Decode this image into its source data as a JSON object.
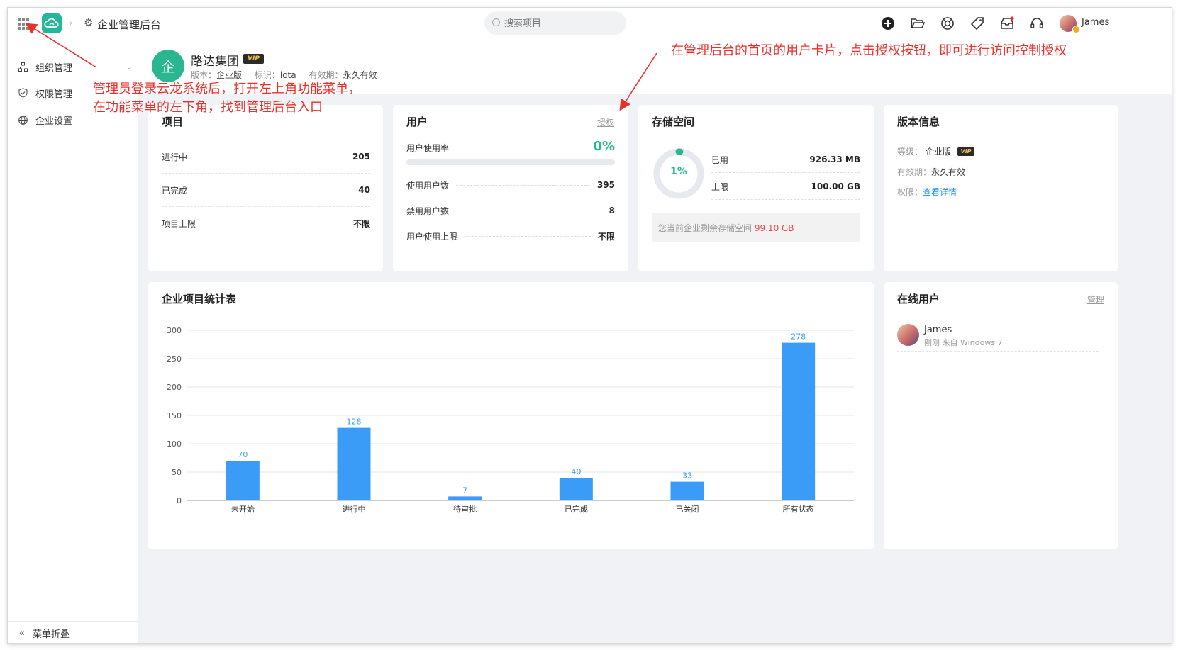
{
  "topbar": {
    "breadcrumb_title": "企业管理后台",
    "search_placeholder": "搜索项目",
    "user_name": "James",
    "icons": [
      "apps-grid-icon",
      "cloud-logo-icon",
      "chevron-right-icon",
      "gear-icon",
      "search-icon",
      "add-circle-icon",
      "folder-open-icon",
      "support-ring-icon",
      "tag-icon",
      "inbox-icon",
      "headset-icon"
    ]
  },
  "sidebar": {
    "items": [
      {
        "label": "组织管理",
        "icon": "org-chart-icon",
        "has_chevron": true
      },
      {
        "label": "权限管理",
        "icon": "shield-check-icon"
      },
      {
        "label": "企业设置",
        "icon": "globe-icon"
      }
    ],
    "collapse_label": "菜单折叠"
  },
  "company": {
    "logo_char": "企",
    "name": "路达集团",
    "vip_label": "VIP",
    "edition_label": "版本：",
    "edition_value": "企业版",
    "id_label": "标识：",
    "id_value": "lota",
    "validity_label": "有效期：",
    "validity_value": "永久有效"
  },
  "projects_card": {
    "title": "项目",
    "rows": [
      {
        "label": "进行中",
        "value": "205"
      },
      {
        "label": "已完成",
        "value": "40"
      },
      {
        "label": "项目上限",
        "value": "不限"
      }
    ]
  },
  "users_card": {
    "title": "用户",
    "authorize_link": "授权",
    "usage_label": "用户使用率",
    "usage_value": "0%",
    "usage_fraction": 0,
    "rows": [
      {
        "label": "使用用户数",
        "value": "395"
      },
      {
        "label": "禁用用户数",
        "value": "8"
      },
      {
        "label": "用户使用上限",
        "value": "不限"
      }
    ]
  },
  "storage_card": {
    "title": "存储空间",
    "percent_label": "1%",
    "percent_fraction": 0.01,
    "used_label": "已用",
    "used_value": "926.33 MB",
    "limit_label": "上限",
    "limit_value": "100.00 GB",
    "note_text": "您当前企业剩余存储空间",
    "note_remaining": "99.10 GB"
  },
  "version_card": {
    "title": "版本信息",
    "level_label": "等级：",
    "level_value": "企业版",
    "vip_label": "VIP",
    "validity_label": "有效期：",
    "validity_value": "永久有效",
    "permission_label": "权限：",
    "permission_link": "查看详情"
  },
  "chart_card": {
    "title": "企业项目统计表"
  },
  "chart_data": {
    "type": "bar",
    "title": "企业项目统计表",
    "categories": [
      "未开始",
      "进行中",
      "待审批",
      "已完成",
      "已关闭",
      "所有状态"
    ],
    "values": [
      70,
      128,
      7,
      40,
      33,
      278
    ],
    "ylim": [
      0,
      300
    ],
    "yticks": [
      0,
      50,
      100,
      150,
      200,
      250,
      300
    ],
    "grid": true,
    "bar_color": "#3a9cf7",
    "label_color": "#3a9cf7"
  },
  "online_card": {
    "title": "在线用户",
    "manage_link": "管理",
    "users": [
      {
        "name": "James",
        "meta": "刚刚 来自 Windows 7"
      }
    ]
  },
  "annotations": {
    "left_line1": "管理员登录云龙系统后，打开左上角功能菜单，",
    "left_line2": "在功能菜单的左下角，找到管理后台入口",
    "right_line": "在管理后台的首页的用户卡片，点击授权按钮，即可进行访问控制授权",
    "color": "#e8302c"
  },
  "colors": {
    "accent_green": "#28b790",
    "link_blue": "#1a8cff",
    "remaining_red": "#e8484e",
    "page_bg": "#f0f2f5"
  }
}
